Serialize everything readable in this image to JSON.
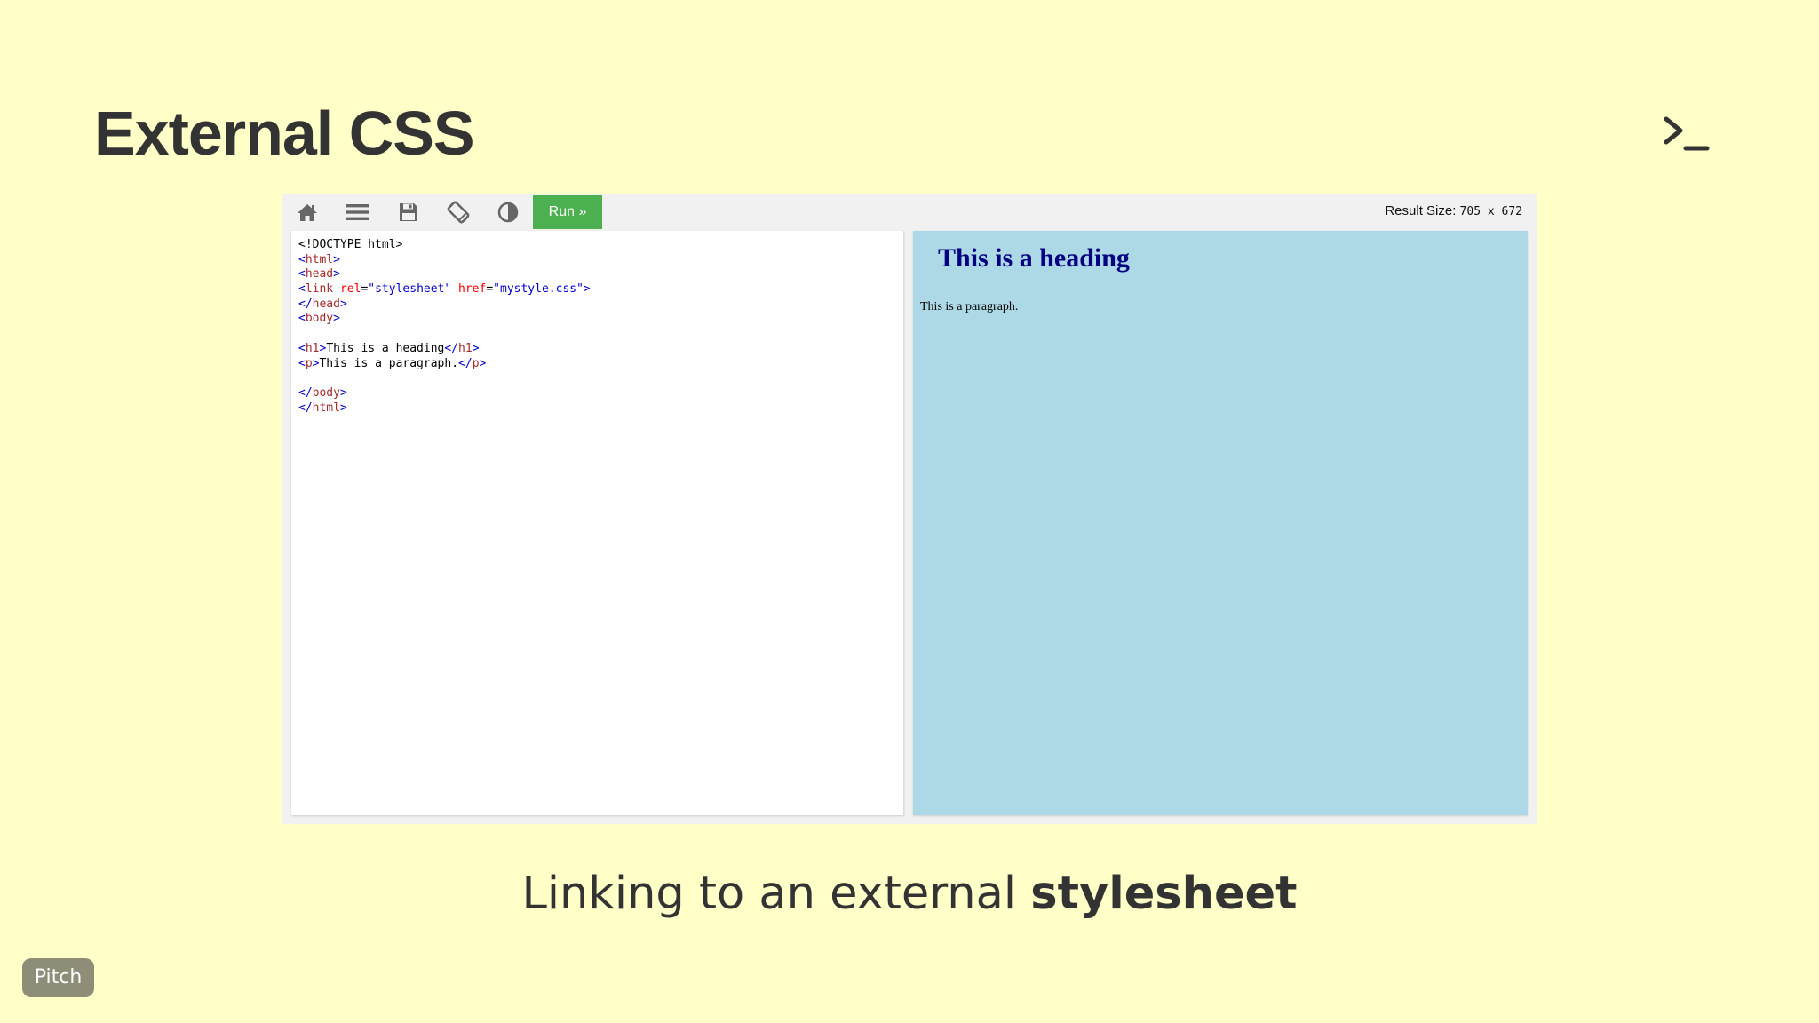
{
  "slide": {
    "title": "External CSS",
    "caption_prefix": "Linking to an external ",
    "caption_bold": "stylesheet",
    "badge": "Pitch"
  },
  "toolbar": {
    "icons": [
      "home-icon",
      "menu-icon",
      "save-icon",
      "rotate-icon",
      "theme-contrast-icon"
    ],
    "run_label": "Run »",
    "result_size_label": "Result Size: ",
    "result_size_value": "705 x 672"
  },
  "code": {
    "lines": [
      "<!DOCTYPE html>",
      "<html>",
      "<head>",
      "<link rel=\"stylesheet\" href=\"mystyle.css\">",
      "</head>",
      "<body>",
      "",
      "<h1>This is a heading</h1>",
      "<p>This is a paragraph.</p>",
      "",
      "</body>",
      "</html>"
    ]
  },
  "result": {
    "heading": "This is a heading",
    "paragraph": "This is a paragraph."
  },
  "colors": {
    "slide_background": "#ffffc8",
    "run_button": "#4caf50",
    "result_background": "#add8e6",
    "result_heading": "#000080"
  }
}
